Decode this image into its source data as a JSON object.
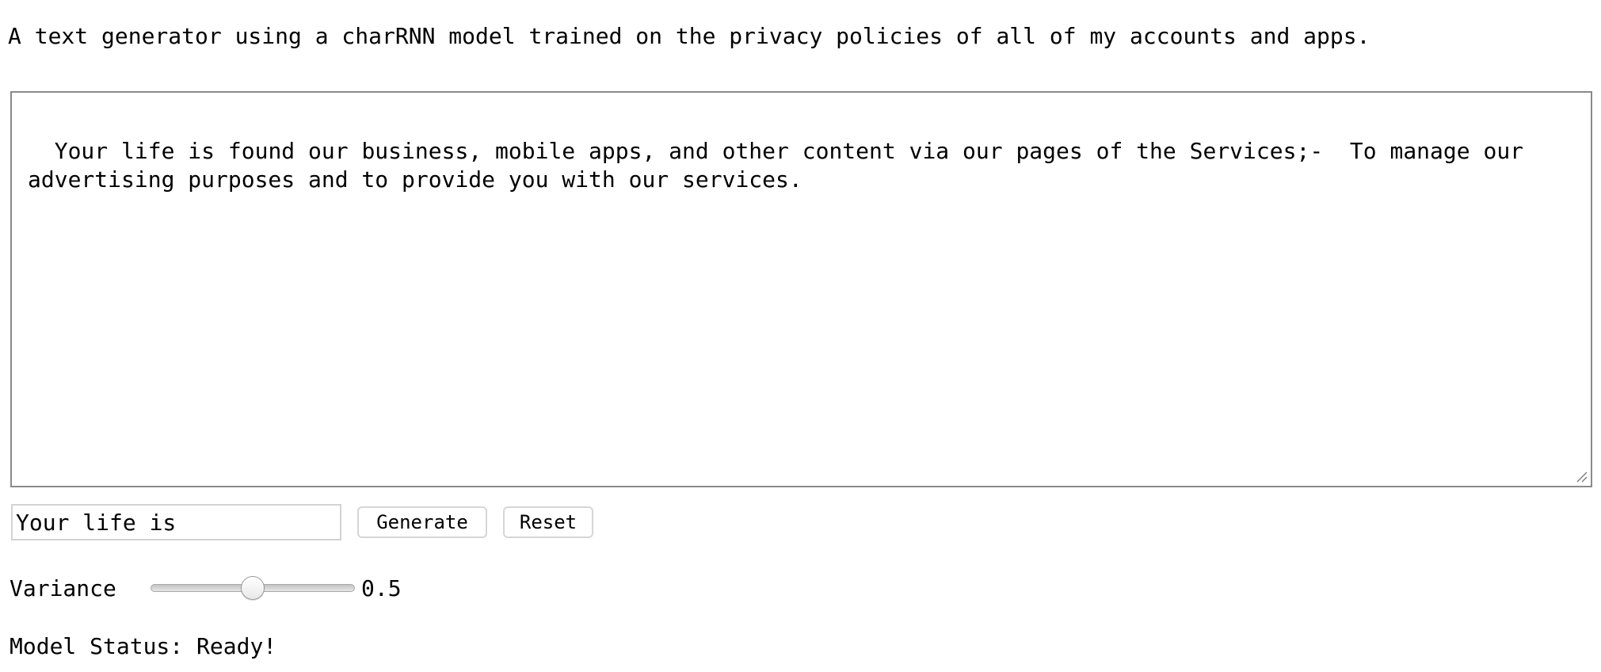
{
  "intro": {
    "text": "A text generator using a charRNN model trained on the privacy policies of all of my accounts and apps."
  },
  "output": {
    "text": "Your life is found our business, mobile apps, and other content via our pages of the Services;-  To manage our advertising purposes and to provide you with our services."
  },
  "controls": {
    "seed_value": "Your life is",
    "generate_label": "Generate",
    "reset_label": "Reset"
  },
  "variance": {
    "label": "Variance",
    "value": "0.5",
    "min": 0,
    "max": 1,
    "level": 0.5
  },
  "status": {
    "label": "Model Status:",
    "value": "Ready!"
  }
}
